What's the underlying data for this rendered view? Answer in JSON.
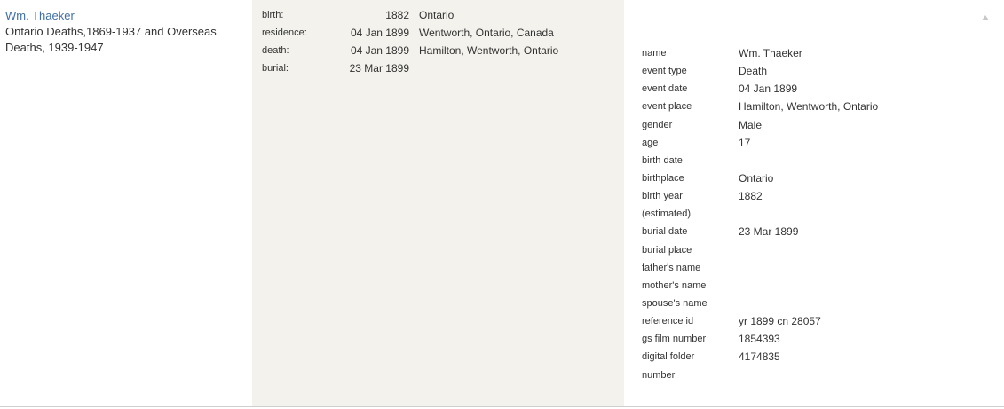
{
  "record": {
    "name": "Wm. Thaeker",
    "collection_line1": "Ontario Deaths,1869-1937 and Overseas",
    "collection_line2": "Deaths, 1939-1947"
  },
  "events": [
    {
      "label": "birth:",
      "date": "1882",
      "place": "Ontario"
    },
    {
      "label": "residence:",
      "date": "04 Jan 1899",
      "place": "Wentworth, Ontario, Canada"
    },
    {
      "label": "death:",
      "date": "04 Jan 1899",
      "place": "Hamilton, Wentworth, Ontario"
    },
    {
      "label": "burial:",
      "date": "23 Mar 1899",
      "place": ""
    }
  ],
  "details": [
    {
      "label": "name",
      "value": "Wm. Thaeker"
    },
    {
      "label": "event type",
      "value": "Death"
    },
    {
      "label": "event date",
      "value": "04 Jan 1899"
    },
    {
      "label": "event place",
      "value": "Hamilton, Wentworth, Ontario"
    },
    {
      "label": "gender",
      "value": "Male"
    },
    {
      "label": "age",
      "value": "17"
    },
    {
      "label": "birth date",
      "value": ""
    },
    {
      "label": "birthplace",
      "value": "Ontario"
    },
    {
      "label": "birth year",
      "value": "1882"
    },
    {
      "label": "(estimated)",
      "value": ""
    },
    {
      "label": "burial date",
      "value": "23 Mar 1899"
    },
    {
      "label": "burial place",
      "value": ""
    },
    {
      "label": "father's name",
      "value": ""
    },
    {
      "label": "mother's name",
      "value": ""
    },
    {
      "label": "spouse's name",
      "value": ""
    },
    {
      "label": "reference id",
      "value": "yr 1899 cn 28057"
    },
    {
      "label": "gs film number",
      "value": "1854393"
    },
    {
      "label": "digital folder",
      "value": "4174835"
    },
    {
      "label": "number",
      "value": ""
    }
  ],
  "icons": {
    "collapse": "caret-up-icon",
    "collapse_color": "#c8c8c8"
  }
}
